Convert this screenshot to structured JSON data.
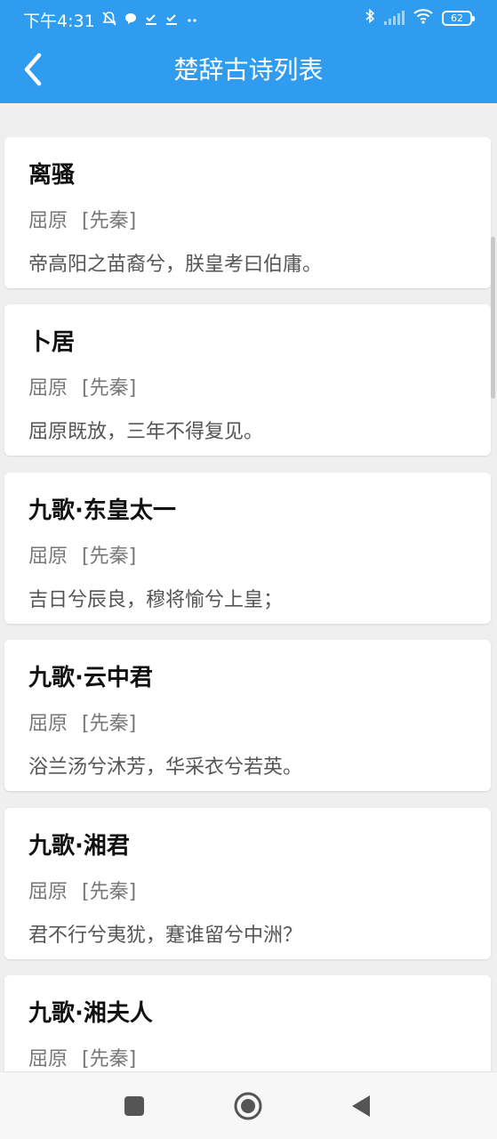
{
  "status_bar": {
    "time": "下午4:31",
    "battery": "62"
  },
  "app_bar": {
    "title": "楚辞古诗列表"
  },
  "poems": [
    {
      "title": "离骚",
      "author": "屈原",
      "dynasty": "[先秦]",
      "line": "帝高阳之苗裔兮，朕皇考曰伯庸。"
    },
    {
      "title": "卜居",
      "author": "屈原",
      "dynasty": "[先秦]",
      "line": "屈原既放，三年不得复见。"
    },
    {
      "title": "九歌·东皇太一",
      "author": "屈原",
      "dynasty": "[先秦]",
      "line": "吉日兮辰良，穆将愉兮上皇；"
    },
    {
      "title": "九歌·云中君",
      "author": "屈原",
      "dynasty": "[先秦]",
      "line": "浴兰汤兮沐芳，华采衣兮若英。"
    },
    {
      "title": "九歌·湘君",
      "author": "屈原",
      "dynasty": "[先秦]",
      "line": "君不行兮夷犹，蹇谁留兮中洲？"
    },
    {
      "title": "九歌·湘夫人",
      "author": "屈原",
      "dynasty": "[先秦]",
      "line": ""
    }
  ],
  "colors": {
    "primary": "#2f9cf0",
    "background": "#efefef"
  },
  "icons": {
    "back": "chevron-left-icon",
    "nav_recent": "square-icon",
    "nav_home": "circle-icon",
    "nav_back": "triangle-left-icon"
  }
}
